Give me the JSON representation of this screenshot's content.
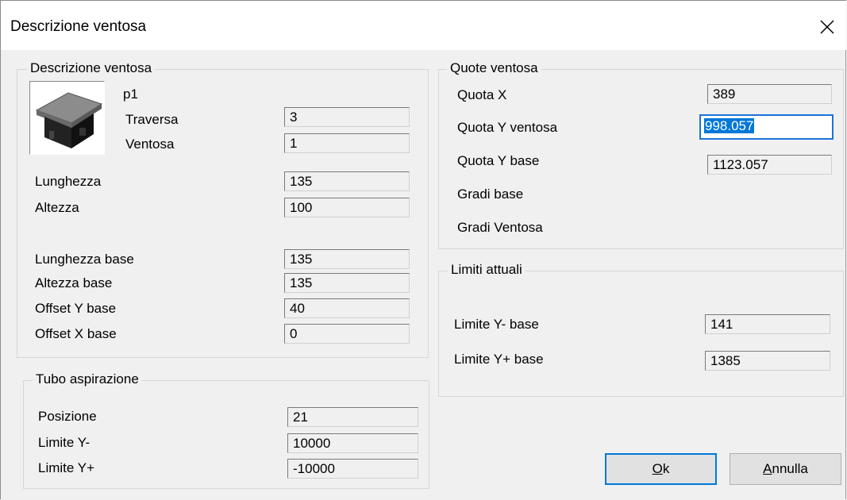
{
  "window": {
    "title": "Descrizione ventosa"
  },
  "left": {
    "group_title": "Descrizione ventosa",
    "name": "p1",
    "traversa": {
      "label": "Traversa",
      "value": "3"
    },
    "ventosa": {
      "label": "Ventosa",
      "value": "1"
    },
    "lunghezza": {
      "label": "Lunghezza",
      "value": "135"
    },
    "altezza": {
      "label": "Altezza",
      "value": "100"
    },
    "lunghezza_base": {
      "label": "Lunghezza base",
      "value": "135"
    },
    "altezza_base": {
      "label": "Altezza base",
      "value": "135"
    },
    "offset_y_base": {
      "label": "Offset Y base",
      "value": "40"
    },
    "offset_x_base": {
      "label": "Offset X base",
      "value": "0"
    }
  },
  "tubo": {
    "group_title": "Tubo aspirazione",
    "posizione": {
      "label": "Posizione",
      "value": "21"
    },
    "limite_y_minus": {
      "label": "Limite Y-",
      "value": "10000"
    },
    "limite_y_plus": {
      "label": "Limite Y+",
      "value": "-10000"
    }
  },
  "quote": {
    "group_title": "Quote ventosa",
    "quota_x": {
      "label": "Quota X",
      "value": "389"
    },
    "quota_y_ventosa": {
      "label": "Quota Y ventosa",
      "value": "998.057"
    },
    "quota_y_base": {
      "label": "Quota Y base",
      "value": "1123.057"
    },
    "gradi_base": {
      "label": "Gradi base"
    },
    "gradi_ventosa": {
      "label": "Gradi Ventosa"
    }
  },
  "limiti": {
    "group_title": "Limiti attuali",
    "limite_y_minus_base": {
      "label": "Limite Y- base",
      "value": "141"
    },
    "limite_y_plus_base": {
      "label": "Limite Y+ base",
      "value": "1385"
    }
  },
  "buttons": {
    "ok_mnemonic": "O",
    "ok_rest": "k",
    "annulla_mnemonic": "A",
    "annulla_rest": "nnulla"
  },
  "colors": {
    "accent": "#0078d7",
    "background": "#f0f0f0"
  },
  "icons": {
    "close": "close-icon",
    "thumbnail": "suction-cup-image"
  }
}
